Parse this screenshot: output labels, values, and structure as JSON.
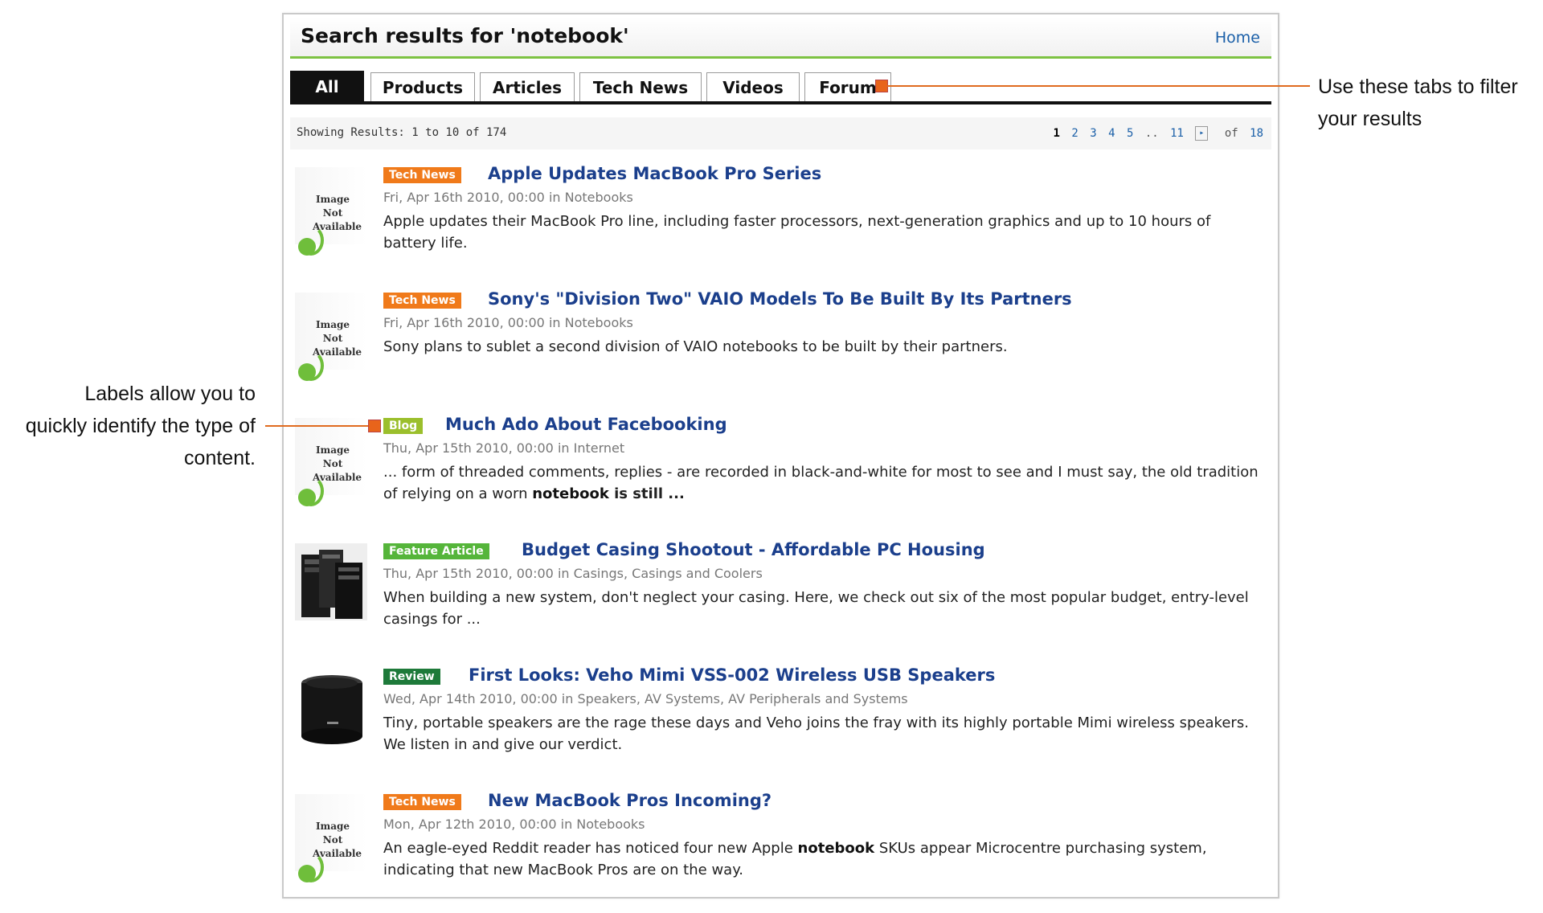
{
  "header": {
    "title": "Search results for 'notebook'",
    "home_label": "Home"
  },
  "tabs": [
    {
      "label": "All",
      "active": true
    },
    {
      "label": "Products"
    },
    {
      "label": "Articles"
    },
    {
      "label": "Tech News"
    },
    {
      "label": "Videos"
    },
    {
      "label": "Forum"
    }
  ],
  "results_bar": {
    "showing": "Showing Results: 1 to 10 of 174",
    "pager": {
      "current": "1",
      "pages": [
        "2",
        "3",
        "4",
        "5"
      ],
      "ellipsis": "..",
      "last_shown": "11",
      "next_glyph": "▸",
      "of_label": "of",
      "total_pages": "18"
    }
  },
  "image_na": {
    "line1": "Image",
    "line2": "Not",
    "line3": "Available"
  },
  "results": [
    {
      "label": "Tech News",
      "title": "Apple Updates MacBook Pro Series",
      "meta": "Fri, Apr 16th 2010, 00:00 in Notebooks",
      "snippet_parts": [
        "Apple updates their MacBook Pro line, including faster processors, next-generation graphics and up to 10 hours of battery life."
      ]
    },
    {
      "label": "Tech News",
      "title": "Sony's \"Division Two\" VAIO Models To Be Built By Its Partners",
      "meta": "Fri, Apr 16th 2010, 00:00 in Notebooks",
      "snippet_parts": [
        "Sony plans to sublet a second division of VAIO notebooks to be built by their partners."
      ]
    },
    {
      "label": "Blog",
      "title": "Much Ado About Facebooking",
      "meta": "Thu, Apr 15th 2010, 00:00 in Internet",
      "snippet_parts": [
        "... form of threaded comments, replies - are recorded in black-and-white for most to see and I must say, the old tradition of relying on a worn ",
        "notebook",
        " is still ..."
      ]
    },
    {
      "label": "Feature Article",
      "title": "Budget Casing Shootout - Affordable PC Housing",
      "meta": "Thu, Apr 15th 2010, 00:00 in Casings, Casings and Coolers",
      "snippet_parts": [
        "When building a new system, don't neglect your casing. Here, we check out six of the most popular budget, entry-level casings for ..."
      ]
    },
    {
      "label": "Review",
      "title": "First Looks: Veho Mimi VSS-002 Wireless USB Speakers",
      "meta": "Wed, Apr 14th 2010, 00:00 in Speakers, AV Systems, AV Peripherals and Systems",
      "snippet_parts": [
        "Tiny, portable speakers are the rage these days and Veho joins the fray with its highly portable Mimi wireless speakers. We listen in and give our verdict."
      ]
    },
    {
      "label": "Tech News",
      "title": "New MacBook Pros Incoming?",
      "meta": "Mon, Apr 12th 2010, 00:00 in Notebooks",
      "snippet_parts": [
        "An eagle-eyed Reddit reader has noticed four new Apple ",
        "notebook",
        " SKUs appear Microcentre purchasing system, indicating that new MacBook Pros are on the way."
      ]
    }
  ],
  "callouts": {
    "tabs_line1": "Use these tabs to filter",
    "tabs_line2": "your results",
    "labels_line1": "Labels allow you to",
    "labels_line2": "quickly identify the type of",
    "labels_line3": "content."
  },
  "colors": {
    "tech_news": "#f07a1a",
    "blog": "#9bbf2c",
    "feature": "#55b53a",
    "review": "#1e7a3a",
    "accent_green": "#7dc243",
    "link_blue": "#1b3f8c"
  }
}
